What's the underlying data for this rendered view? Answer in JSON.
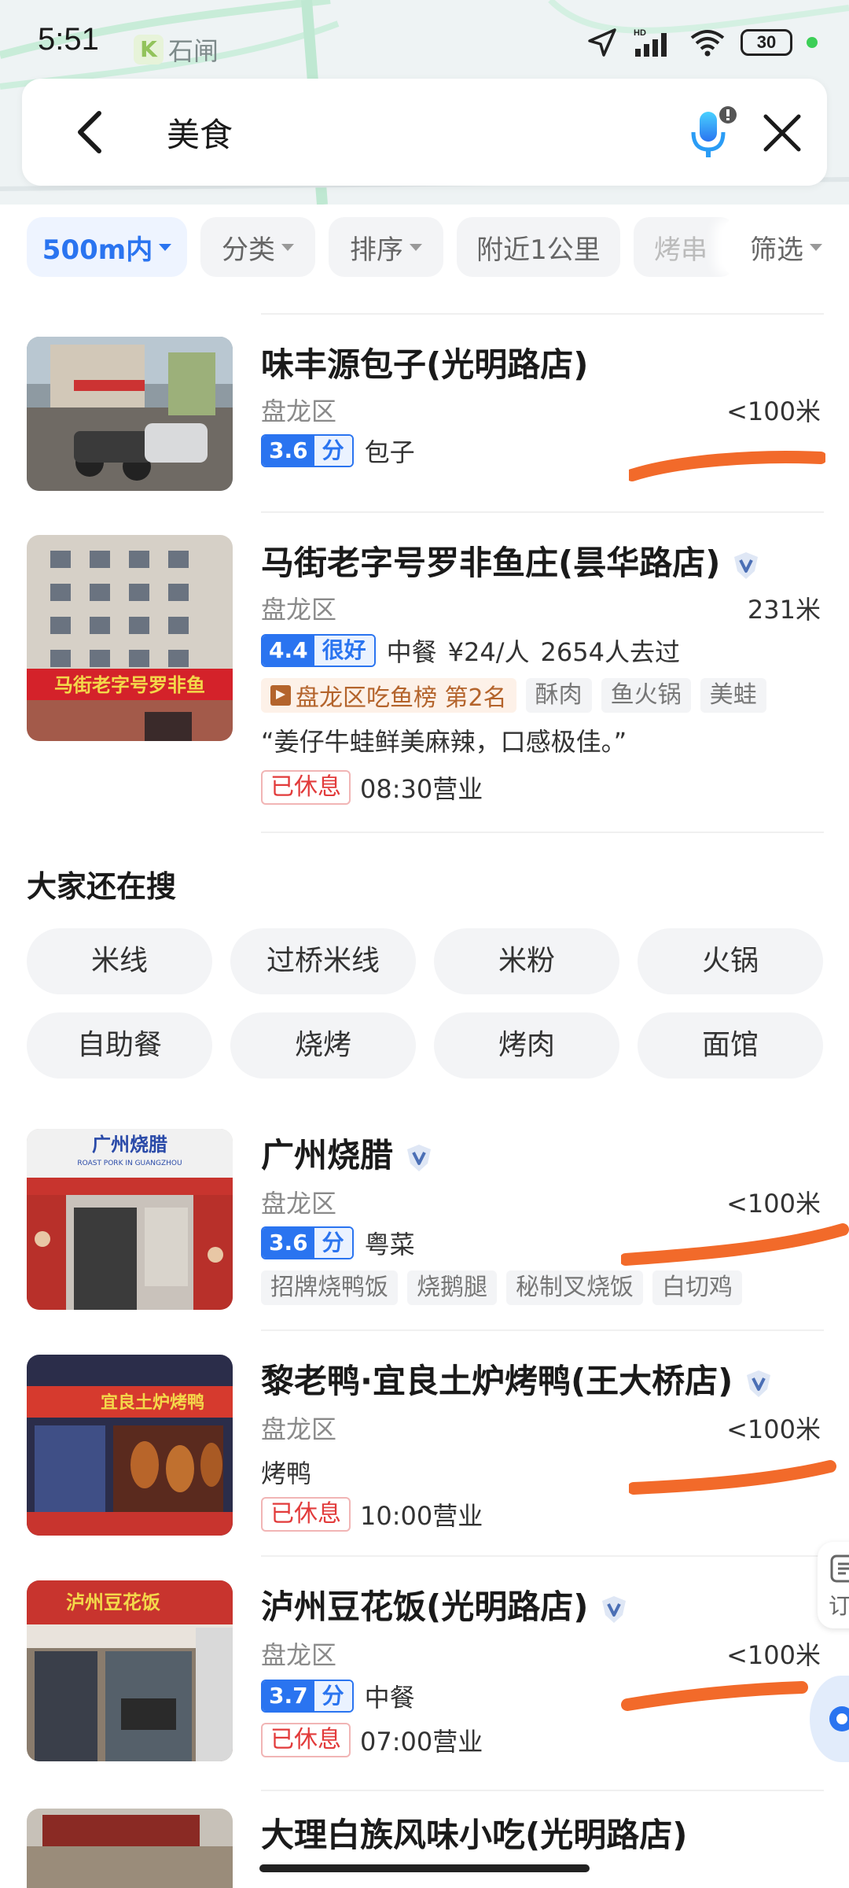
{
  "status_bar": {
    "time": "5:51",
    "app_label": "石闸",
    "battery": "30",
    "network": "HD"
  },
  "search": {
    "query": "美食"
  },
  "filters": [
    {
      "label": "500m内",
      "caret": true,
      "active": true
    },
    {
      "label": "分类",
      "caret": true,
      "active": false
    },
    {
      "label": "排序",
      "caret": true,
      "active": false
    },
    {
      "label": "附近1公里",
      "caret": false,
      "active": false
    },
    {
      "label": "烤串",
      "caret": false,
      "active": false
    },
    {
      "label": "筛选",
      "caret": true,
      "active": false
    }
  ],
  "results": [
    {
      "name": "味丰源包子(光明路店)",
      "district": "盘龙区",
      "distance": "<100米",
      "score": "3.6",
      "score_label": "分",
      "category": "包子"
    },
    {
      "name": "马街老字号罗非鱼庄(昙华路店)",
      "verified": true,
      "district": "盘龙区",
      "distance": "231米",
      "score": "4.4",
      "score_label": "很好",
      "category": "中餐",
      "price": "¥24/人",
      "visits": "2654人去过",
      "rank": "盘龙区吃鱼榜 第2名",
      "tags": [
        "酥肉",
        "鱼火锅",
        "美蛙"
      ],
      "review": "“姜仔牛蛙鲜美麻辣，口感极佳。”",
      "status": "已休息",
      "open_time": "08:30营业",
      "sign_text": "马街老字号罗非鱼"
    },
    {
      "name": "广州烧腊",
      "verified": true,
      "district": "盘龙区",
      "distance": "<100米",
      "score": "3.6",
      "score_label": "分",
      "category": "粤菜",
      "tags": [
        "招牌烧鸭饭",
        "烧鹅腿",
        "秘制叉烧饭",
        "白切鸡"
      ],
      "sign_text": "广州烧腊",
      "sign_sub": "ROAST PORK IN GUANGZHOU"
    },
    {
      "name": "黎老鸭·宜良土炉烤鸭(王大桥店)",
      "verified": true,
      "district": "盘龙区",
      "distance": "<100米",
      "category": "烤鸭",
      "status": "已休息",
      "open_time": "10:00营业",
      "sign_text": "宜良土炉烤鸭"
    },
    {
      "name": "泸州豆花饭(光明路店)",
      "verified": true,
      "district": "盘龙区",
      "distance": "<100米",
      "score": "3.7",
      "score_label": "分",
      "category": "中餐",
      "status": "已休息",
      "open_time": "07:00营业",
      "sign_text": "泸州豆花饭"
    },
    {
      "name": "大理白族风味小吃(光明路店)"
    }
  ],
  "also_search": {
    "title": "大家还在搜",
    "keywords": [
      "米线",
      "过桥米线",
      "米粉",
      "火锅",
      "自助餐",
      "烧烤",
      "烤肉",
      "面馆"
    ]
  },
  "side": {
    "order_label": "订"
  },
  "colors": {
    "accent": "#2a74f0",
    "closed": "#e23b3b",
    "rank": "#b4642c",
    "scribble": "#f26a2a"
  }
}
